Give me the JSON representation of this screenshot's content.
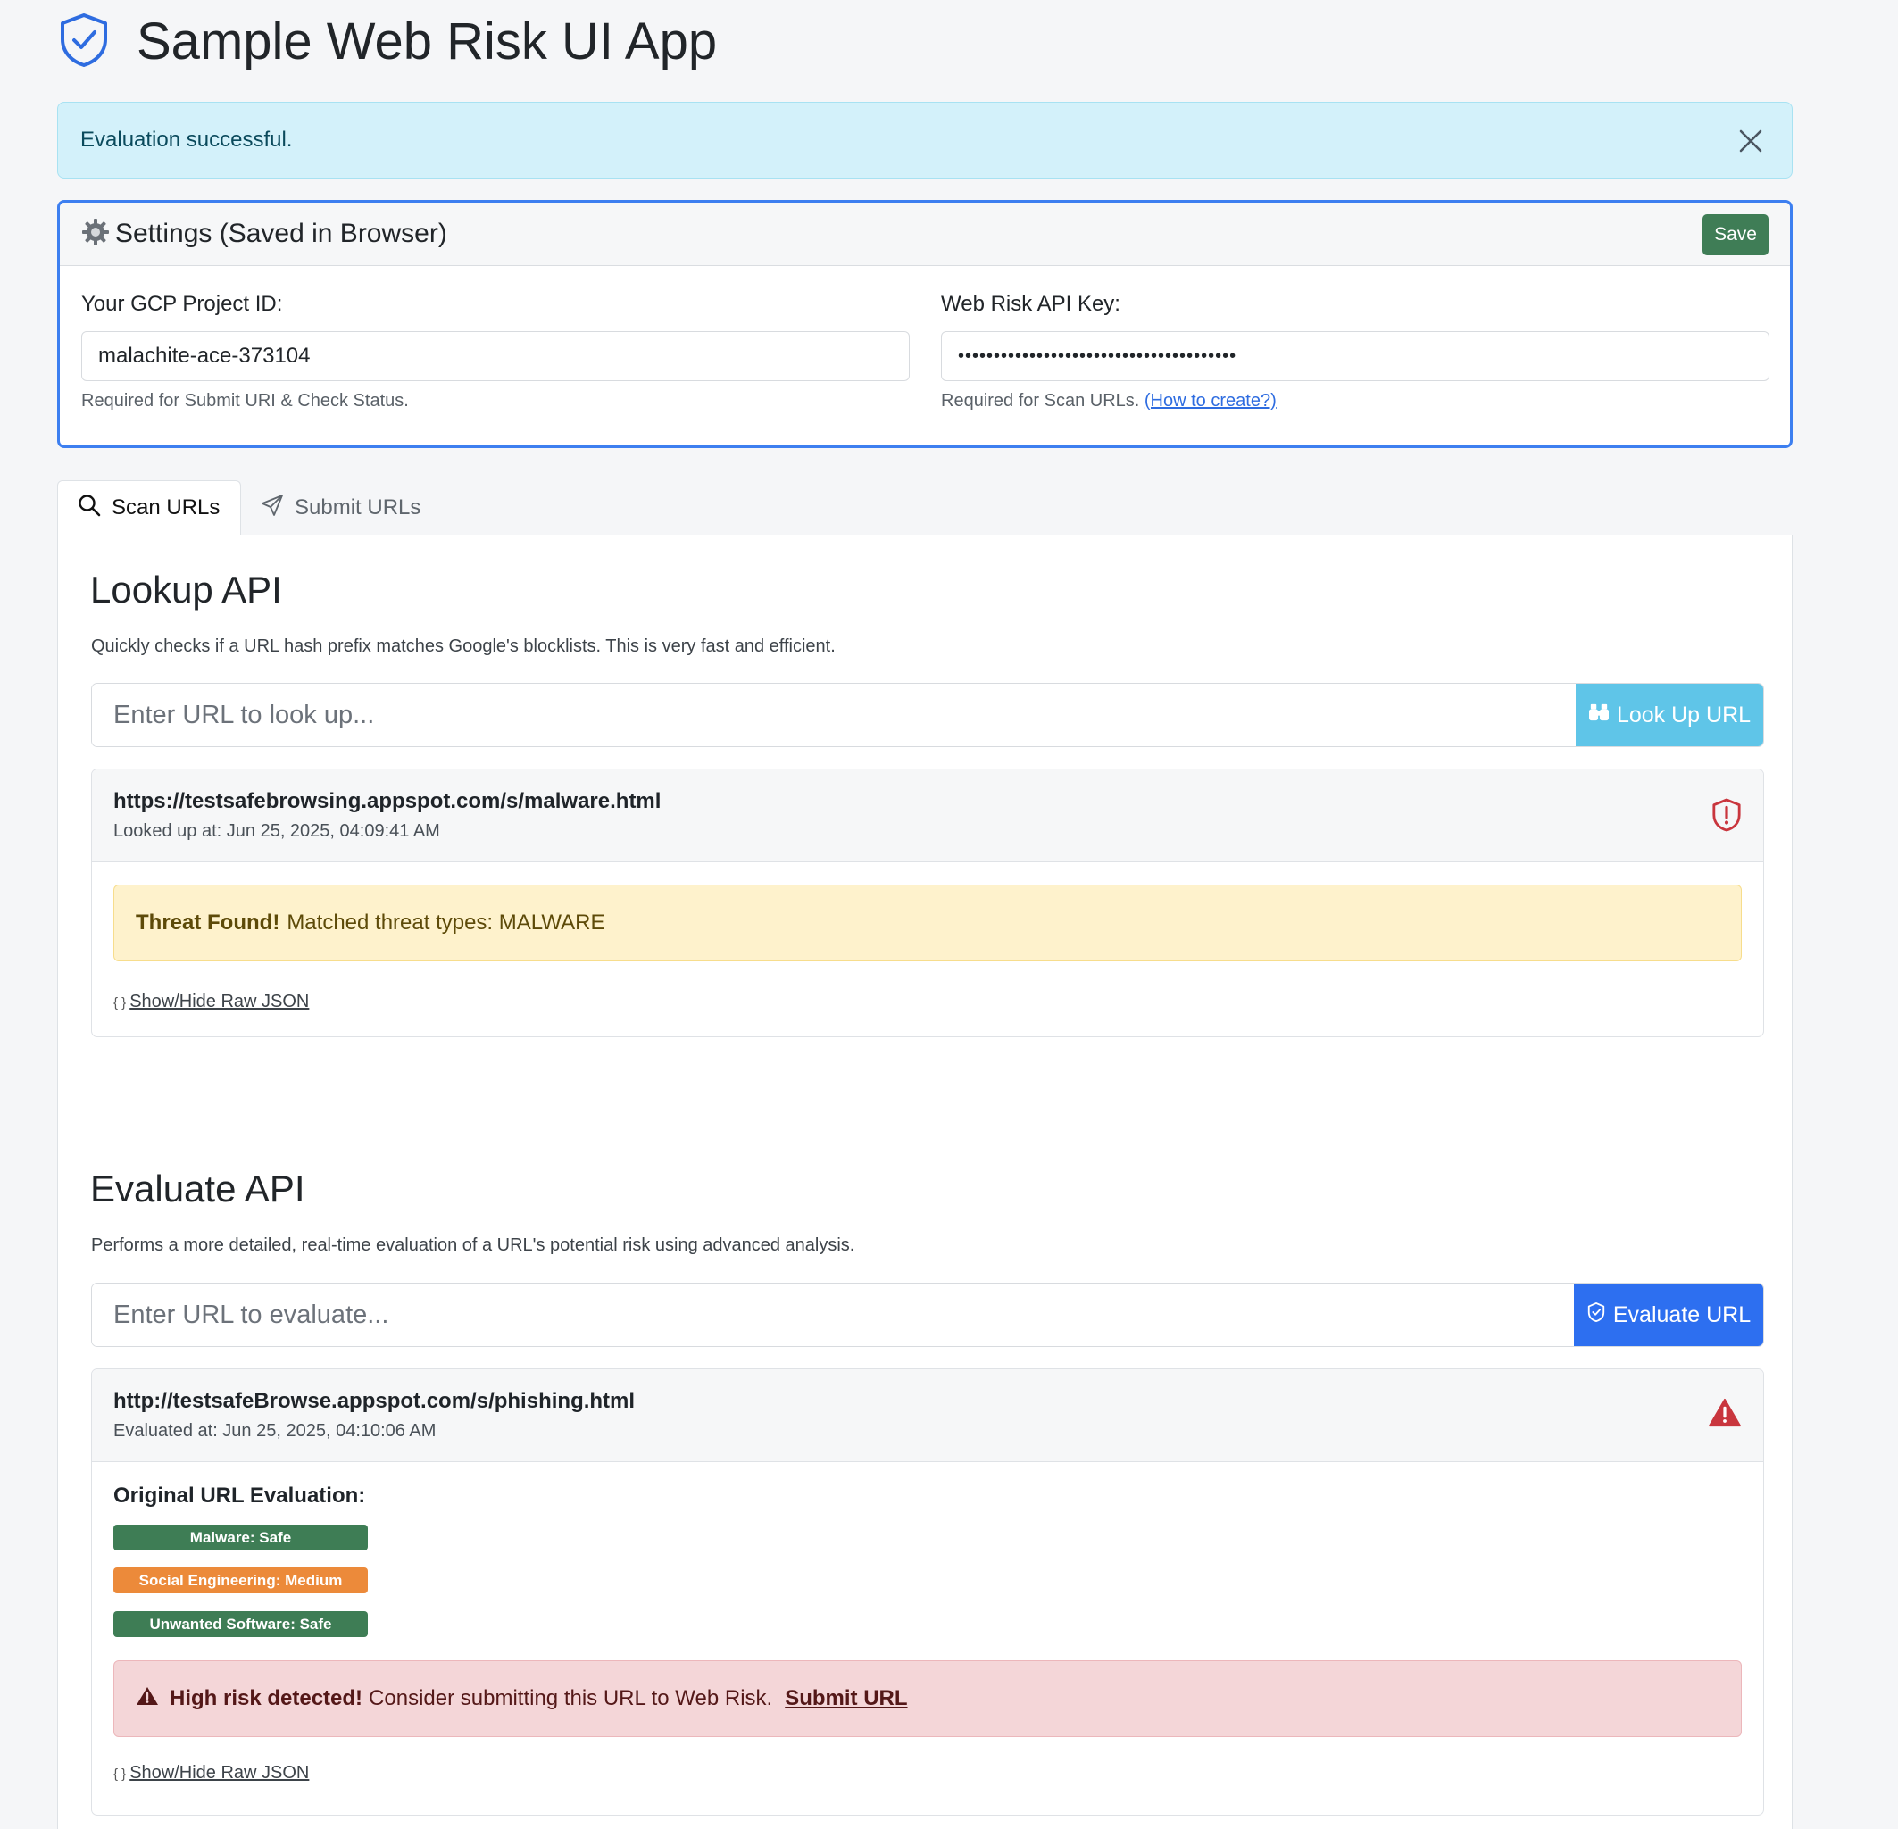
{
  "app": {
    "title": "Sample Web Risk UI App"
  },
  "alert": {
    "message": "Evaluation successful."
  },
  "settings": {
    "title": "Settings (Saved in Browser)",
    "save_label": "Save",
    "project_id_label": "Your GCP Project ID:",
    "project_id_value": "malachite-ace-373104",
    "project_id_help": "Required for Submit URI & Check Status.",
    "api_key_label": "Web Risk API Key:",
    "api_key_masked": "•••••••••••••••••••••••••••••••••••••••",
    "api_key_help": "Required for Scan URLs.",
    "api_key_help_link": "(How to create?)"
  },
  "tabs": [
    {
      "label": "Scan URLs",
      "active": true
    },
    {
      "label": "Submit URLs",
      "active": false
    }
  ],
  "lookup": {
    "title": "Lookup API",
    "description": "Quickly checks if a URL hash prefix matches Google's blocklists. This is very fast and efficient.",
    "input_placeholder": "Enter URL to look up...",
    "button_label": "Look Up URL",
    "result": {
      "url": "https://testsafebrowsing.appspot.com/s/malware.html",
      "timestamp": "Looked up at: Jun 25, 2025, 04:09:41 AM",
      "threat_strong": "Threat Found!",
      "threat_text": "Matched threat types: MALWARE",
      "raw_json_braces": "{ }",
      "raw_json_label": "Show/Hide Raw JSON"
    }
  },
  "evaluate": {
    "title": "Evaluate API",
    "description": "Performs a more detailed, real-time evaluation of a URL's potential risk using advanced analysis.",
    "input_placeholder": "Enter URL to evaluate...",
    "button_label": "Evaluate URL",
    "result": {
      "url": "http://testsafeBrowse.appspot.com/s/phishing.html",
      "timestamp": "Evaluated at: Jun 25, 2025, 04:10:06 AM",
      "section_label": "Original URL Evaluation:",
      "badges": [
        {
          "label": "Malware: Safe",
          "level": "safe"
        },
        {
          "label": "Social Engineering: Medium",
          "level": "medium"
        },
        {
          "label": "Unwanted Software: Safe",
          "level": "safe"
        }
      ],
      "risk_strong": "High risk detected!",
      "risk_text": "Consider submitting this URL to Web Risk.",
      "risk_link": "Submit URL",
      "raw_json_braces": "{ }",
      "raw_json_label": "Show/Hide Raw JSON"
    }
  },
  "colors": {
    "accent": "#3d7ff0",
    "save": "#3f7d56",
    "lookup_button": "#5fc5e8",
    "evaluate_button": "#2d6ff0",
    "safe": "#3e7d55",
    "medium": "#ec8a3a",
    "danger": "#c9363e"
  }
}
